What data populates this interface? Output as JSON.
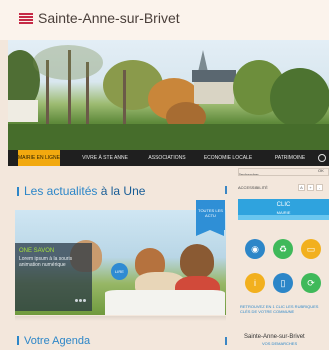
{
  "header": {
    "site_title": "Sainte-Anne-sur-Brivet",
    "logo_colors": [
      "#c52a46",
      "#f7e4e4"
    ]
  },
  "nav": {
    "items": [
      {
        "label": "MAIRIE EN LIGNE",
        "active": true
      },
      {
        "label": "VIVRE À STE ANNE",
        "active": false
      },
      {
        "label": "ASSOCIATIONS",
        "active": false
      },
      {
        "label": "ECONOMIE LOCALE",
        "active": false
      },
      {
        "label": "PATRIMOINE",
        "active": false
      }
    ],
    "search_icon": "search-icon"
  },
  "news": {
    "heading_prefix": "Les actualités",
    "heading_strong": "à la Une",
    "ribbon_label": "TOUTES LES ACTU",
    "card_title": "ONE SAVON",
    "card_text": "Lorem ipsum à la souris animation numérique",
    "read_button": "LIRE"
  },
  "sidebar": {
    "search_label": "Rechercher",
    "search_tag": "OK",
    "accessibility_label": "ACCESSIBILITÉ",
    "font_controls": [
      "A",
      "+",
      "-"
    ],
    "clic_title": "CLIC",
    "clic_subtitle": "MAIRIE",
    "icons": [
      {
        "name": "globe-icon",
        "color": "#2c86c8",
        "glyph": "◉"
      },
      {
        "name": "recycle-icon",
        "color": "#3fb95a",
        "glyph": "♻"
      },
      {
        "name": "card-icon",
        "color": "#f2b01e",
        "glyph": "▭"
      },
      {
        "name": "info-icon",
        "color": "#f2b01e",
        "glyph": "i"
      },
      {
        "name": "document-icon",
        "color": "#2c86c8",
        "glyph": "▯"
      },
      {
        "name": "share-icon",
        "color": "#3fb95a",
        "glyph": "⟳"
      }
    ],
    "note": "RETROUVEZ EN 1 CLIC LES RUBRIQUES CLÉS DE VOTRE COMMUNE"
  },
  "agenda": {
    "heading": "Votre Agenda",
    "right_title": "Sainte-Anne-sur-Brivet",
    "right_sub": "VOS DEMARCHES"
  }
}
